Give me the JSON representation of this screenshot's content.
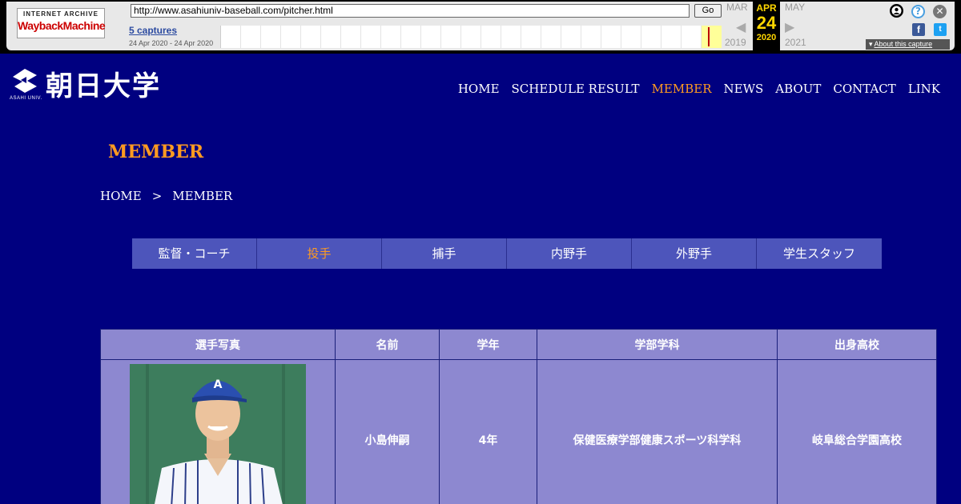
{
  "wayback": {
    "logo_top": "INTERNET ARCHIVE",
    "logo_bottom": "WaybackMachine",
    "url": "http://www.asahiuniv-baseball.com/pitcher.html",
    "go_label": "Go",
    "captures_label": "5 captures",
    "date_range": "24 Apr 2020 - 24 Apr 2020",
    "prev_month": "MAR",
    "prev_year": "2019",
    "current_month": "APR",
    "current_day": "24",
    "current_year": "2020",
    "next_month": "MAY",
    "next_year": "2021",
    "about_label": "About this capture",
    "icons": [
      "user-icon",
      "help-icon",
      "close-icon",
      "facebook-icon",
      "twitter-icon"
    ]
  },
  "site": {
    "logo_text": "朝日大学",
    "logo_sub": "ASAHI UNIV."
  },
  "nav": {
    "items": [
      {
        "label": "HOME",
        "active": false
      },
      {
        "label": "SCHEDULE RESULT",
        "active": false
      },
      {
        "label": "MEMBER",
        "active": true
      },
      {
        "label": "NEWS",
        "active": false
      },
      {
        "label": "ABOUT",
        "active": false
      },
      {
        "label": "CONTACT",
        "active": false
      },
      {
        "label": "LINK",
        "active": false
      }
    ]
  },
  "page": {
    "title": "MEMBER",
    "breadcrumb": [
      "HOME",
      ">",
      "MEMBER"
    ]
  },
  "tabs": [
    {
      "label": "監督・コーチ",
      "active": false
    },
    {
      "label": "投手",
      "active": true
    },
    {
      "label": "捕手",
      "active": false
    },
    {
      "label": "内野手",
      "active": false
    },
    {
      "label": "外野手",
      "active": false
    },
    {
      "label": "学生スタッフ",
      "active": false
    }
  ],
  "roster": {
    "headers": [
      "選手写真",
      "名前",
      "学年",
      "学部学科",
      "出身高校"
    ],
    "rows": [
      {
        "name": "小島伸嗣",
        "grade": "4年",
        "faculty": "保健医療学部健康スポーツ科学科",
        "school": "岐阜総合学園高校"
      }
    ]
  },
  "colors": {
    "background": "#000080",
    "accent": "#ff9b21",
    "tab_bg": "#4d55bb",
    "table_bg": "#8d88d0"
  }
}
